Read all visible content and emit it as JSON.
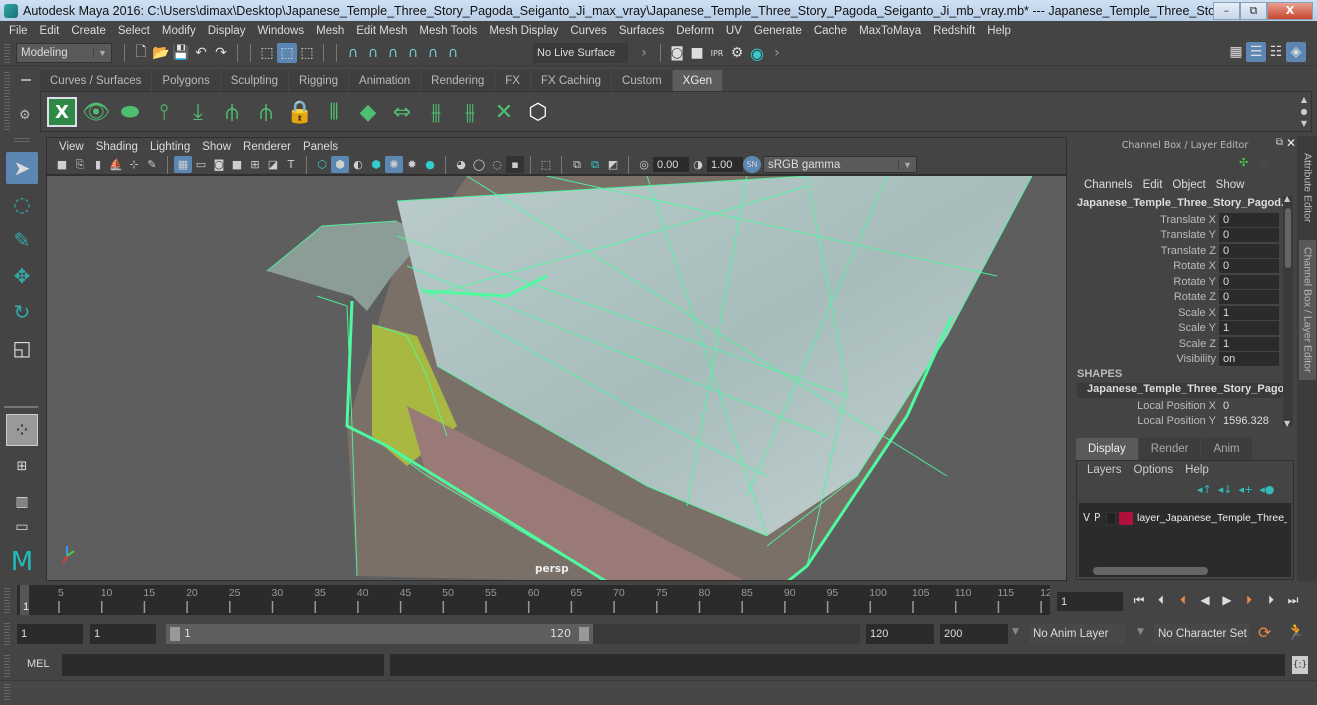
{
  "window": {
    "title": "Autodesk Maya 2016: C:\\Users\\dimax\\Desktop\\Japanese_Temple_Three_Story_Pagoda_Seiganto_Ji_max_vray\\Japanese_Temple_Three_Story_Pagoda_Seiganto_Ji_mb_vray.mb*   ---   Japanese_Temple_Three_Story_Pagoda_Seiganto_...",
    "minimize": "–",
    "restore": "⧉",
    "close": "X"
  },
  "menubar": [
    "File",
    "Edit",
    "Create",
    "Select",
    "Modify",
    "Display",
    "Windows",
    "Mesh",
    "Edit Mesh",
    "Mesh Tools",
    "Mesh Display",
    "Curves",
    "Surfaces",
    "Deform",
    "UV",
    "Generate",
    "Cache",
    "MaxToMaya",
    "Redshift",
    "Help"
  ],
  "statusline": {
    "mode": "Modeling",
    "live_surface": "No Live Surface",
    "render_icons": [
      "render-view-icon",
      "render-frame-icon",
      "ipr-render-icon",
      "render-settings-icon",
      "hypershade-icon"
    ]
  },
  "shelf": {
    "tabs": [
      {
        "label": "Curves / Surfaces",
        "active": false
      },
      {
        "label": "Polygons",
        "active": false
      },
      {
        "label": "Sculpting",
        "active": false
      },
      {
        "label": "Rigging",
        "active": false
      },
      {
        "label": "Animation",
        "active": false
      },
      {
        "label": "Rendering",
        "active": false
      },
      {
        "label": "FX",
        "active": false
      },
      {
        "label": "FX Caching",
        "active": false
      },
      {
        "label": "Custom",
        "active": false
      },
      {
        "label": "XGen",
        "active": true
      }
    ],
    "icons": [
      "xgen-editor-icon",
      "xgen-preview-icon",
      "xgen-hide-icon",
      "add-guides-icon",
      "place-guides-icon",
      "add-guide-icon",
      "sculpt-guide-icon",
      "lock-guide-icon",
      "split-guide-icon",
      "guide-layer-icon",
      "move-guide-icon",
      "select-guides-icon",
      "clear-guides-icon",
      "delete-guide-icon",
      "xgen-interactive-grooming-icon"
    ]
  },
  "viewport": {
    "menus": [
      "View",
      "Shading",
      "Lighting",
      "Show",
      "Renderer",
      "Panels"
    ],
    "exposure": "0.00",
    "gamma": "1.00",
    "color_space": "sRGB gamma",
    "camera_label": "persp"
  },
  "channel_box": {
    "title": "Channel Box / Layer Editor",
    "menus": [
      "Channels",
      "Edit",
      "Object",
      "Show"
    ],
    "object_name": "Japanese_Temple_Three_Story_Pagod...",
    "channels": [
      {
        "label": "Translate X",
        "value": "0"
      },
      {
        "label": "Translate Y",
        "value": "0"
      },
      {
        "label": "Translate Z",
        "value": "0"
      },
      {
        "label": "Rotate X",
        "value": "0"
      },
      {
        "label": "Rotate Y",
        "value": "0"
      },
      {
        "label": "Rotate Z",
        "value": "0"
      },
      {
        "label": "Scale X",
        "value": "1"
      },
      {
        "label": "Scale Y",
        "value": "1"
      },
      {
        "label": "Scale Z",
        "value": "1"
      },
      {
        "label": "Visibility",
        "value": "on"
      }
    ],
    "shapes_header": "SHAPES",
    "shape_name": "Japanese_Temple_Three_Story_Pago...",
    "shape_channels": [
      {
        "label": "Local Position X",
        "value": "0"
      },
      {
        "label": "Local Position Y",
        "value": "1596.328"
      }
    ]
  },
  "side_tabs": [
    "Attribute Editor",
    "Channel Box / Layer Editor"
  ],
  "layer_editor": {
    "tabs": [
      {
        "label": "Display",
        "active": true
      },
      {
        "label": "Render",
        "active": false
      },
      {
        "label": "Anim",
        "active": false
      }
    ],
    "menus": [
      "Layers",
      "Options",
      "Help"
    ],
    "layer": {
      "v": "V",
      "p": "P",
      "color": "#b0103a",
      "name": "layer_Japanese_Temple_Three_S"
    }
  },
  "timeline": {
    "ticks": [
      "5",
      "10",
      "15",
      "20",
      "25",
      "30",
      "35",
      "40",
      "45",
      "50",
      "55",
      "60",
      "65",
      "70",
      "75",
      "80",
      "85",
      "90",
      "95",
      "100",
      "105",
      "110",
      "115",
      "12"
    ],
    "current_frame_marker": "1",
    "current_frame": "1"
  },
  "range": {
    "start_time": "1",
    "playback_start": "1",
    "slider_start": "1",
    "slider_end": "120",
    "playback_end": "120",
    "end_time": "200",
    "anim_layer": "No Anim Layer",
    "character_set": "No Character Set"
  },
  "cmdline": {
    "label": "MEL",
    "value": ""
  },
  "colors": {
    "accent": "#5d87b3",
    "wireframe": "#4dfaa0",
    "selection_green": "#4fbf6f"
  }
}
